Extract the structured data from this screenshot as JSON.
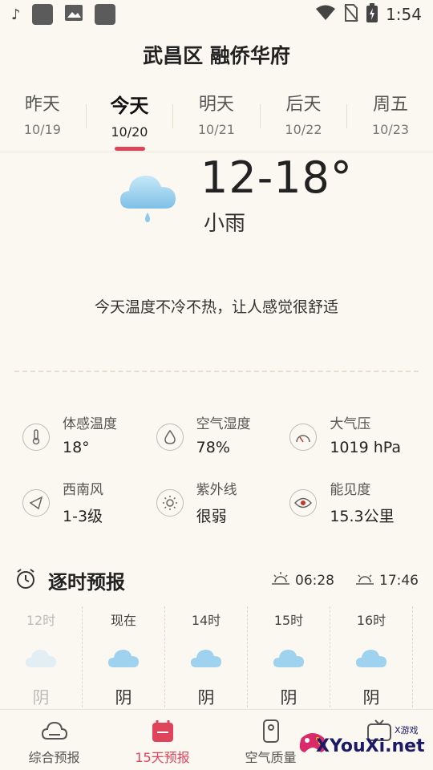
{
  "statusbar": {
    "time": "1:54"
  },
  "location": "武昌区 融侨华府",
  "days": [
    {
      "name": "昨天",
      "date": "10/19",
      "active": false
    },
    {
      "name": "今天",
      "date": "10/20",
      "active": true
    },
    {
      "name": "明天",
      "date": "10/21",
      "active": false
    },
    {
      "name": "后天",
      "date": "10/22",
      "active": false
    },
    {
      "name": "周五",
      "date": "10/23",
      "active": false
    }
  ],
  "current": {
    "temp_range": "12-18°",
    "condition": "小雨",
    "tip": "今天温度不冷不热，让人感觉很舒适",
    "icon": "light-rain-icon"
  },
  "details": [
    {
      "label": "体感温度",
      "value": "18°",
      "icon": "thermometer-icon"
    },
    {
      "label": "空气湿度",
      "value": "78%",
      "icon": "humidity-drop-icon"
    },
    {
      "label": "大气压",
      "value": "1019 hPa",
      "icon": "pressure-gauge-icon"
    },
    {
      "label": "西南风",
      "value": "1-3级",
      "icon": "wind-direction-icon"
    },
    {
      "label": "紫外线",
      "value": "很弱",
      "icon": "uv-sun-icon"
    },
    {
      "label": "能见度",
      "value": "15.3公里",
      "icon": "visibility-eye-icon"
    }
  ],
  "hourly": {
    "title": "逐时预报",
    "sunrise": "06:28",
    "sunset": "17:46",
    "items": [
      {
        "time": "12时",
        "condition": "阴"
      },
      {
        "time": "现在",
        "condition": "阴"
      },
      {
        "time": "14时",
        "condition": "阴"
      },
      {
        "time": "15时",
        "condition": "阴"
      },
      {
        "time": "16时",
        "condition": "阴"
      }
    ]
  },
  "nav": [
    {
      "label": "综合预报",
      "icon": "cloud-outline-icon",
      "active": false
    },
    {
      "label": "15天预报",
      "icon": "calendar-icon",
      "active": true
    },
    {
      "label": "空气质量",
      "icon": "air-purifier-icon",
      "active": false
    },
    {
      "label": "",
      "icon": "tv-icon",
      "active": false
    }
  ],
  "watermark": {
    "text": "XYouXi.net",
    "small": "X游戏"
  },
  "colors": {
    "accent": "#e0445a",
    "background": "#fbf7f1",
    "cloud": "#8ecbea"
  }
}
